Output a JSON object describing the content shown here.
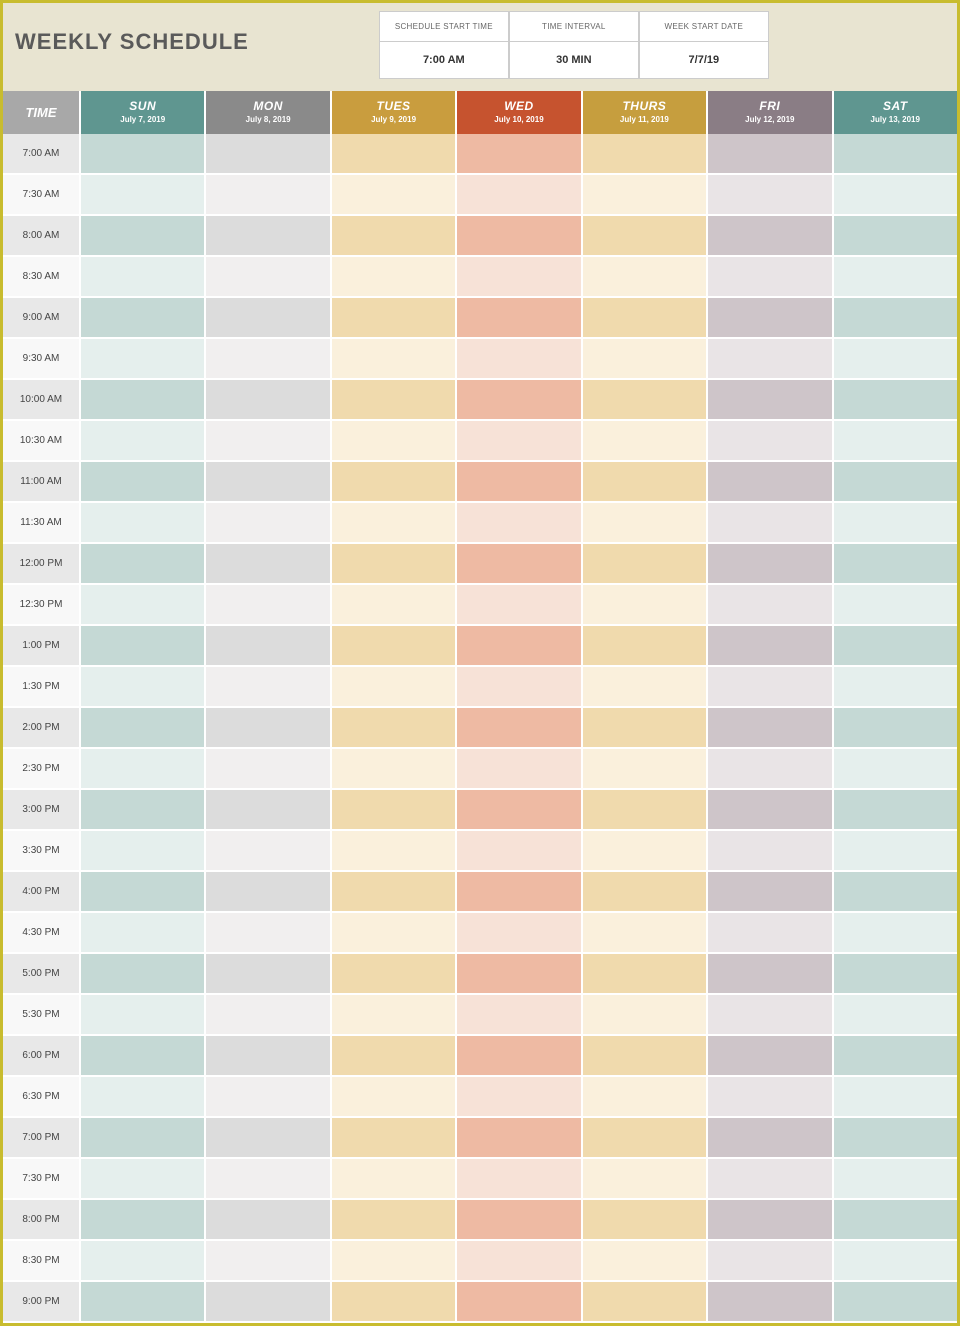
{
  "title": "WEEKLY SCHEDULE",
  "config": [
    {
      "label": "SCHEDULE START TIME",
      "value": "7:00 AM"
    },
    {
      "label": "TIME INTERVAL",
      "value": "30 MIN"
    },
    {
      "label": "WEEK START DATE",
      "value": "7/7/19"
    }
  ],
  "time_header": "TIME",
  "days": [
    {
      "name": "SUN",
      "date": "July 7, 2019",
      "cls": "sun"
    },
    {
      "name": "MON",
      "date": "July 8, 2019",
      "cls": "mon"
    },
    {
      "name": "TUES",
      "date": "July 9, 2019",
      "cls": "tue"
    },
    {
      "name": "WED",
      "date": "July 10, 2019",
      "cls": "wed"
    },
    {
      "name": "THURS",
      "date": "July 11, 2019",
      "cls": "thu"
    },
    {
      "name": "FRI",
      "date": "July 12, 2019",
      "cls": "fri"
    },
    {
      "name": "SAT",
      "date": "July 13, 2019",
      "cls": "sat"
    }
  ],
  "times": [
    "7:00 AM",
    "7:30 AM",
    "8:00 AM",
    "8:30 AM",
    "9:00 AM",
    "9:30 AM",
    "10:00 AM",
    "10:30 AM",
    "11:00 AM",
    "11:30 AM",
    "12:00 PM",
    "12:30 PM",
    "1:00 PM",
    "1:30 PM",
    "2:00 PM",
    "2:30 PM",
    "3:00 PM",
    "3:30 PM",
    "4:00 PM",
    "4:30 PM",
    "5:00 PM",
    "5:30 PM",
    "6:00 PM",
    "6:30 PM",
    "7:00 PM",
    "7:30 PM",
    "8:00 PM",
    "8:30 PM",
    "9:00 PM"
  ]
}
